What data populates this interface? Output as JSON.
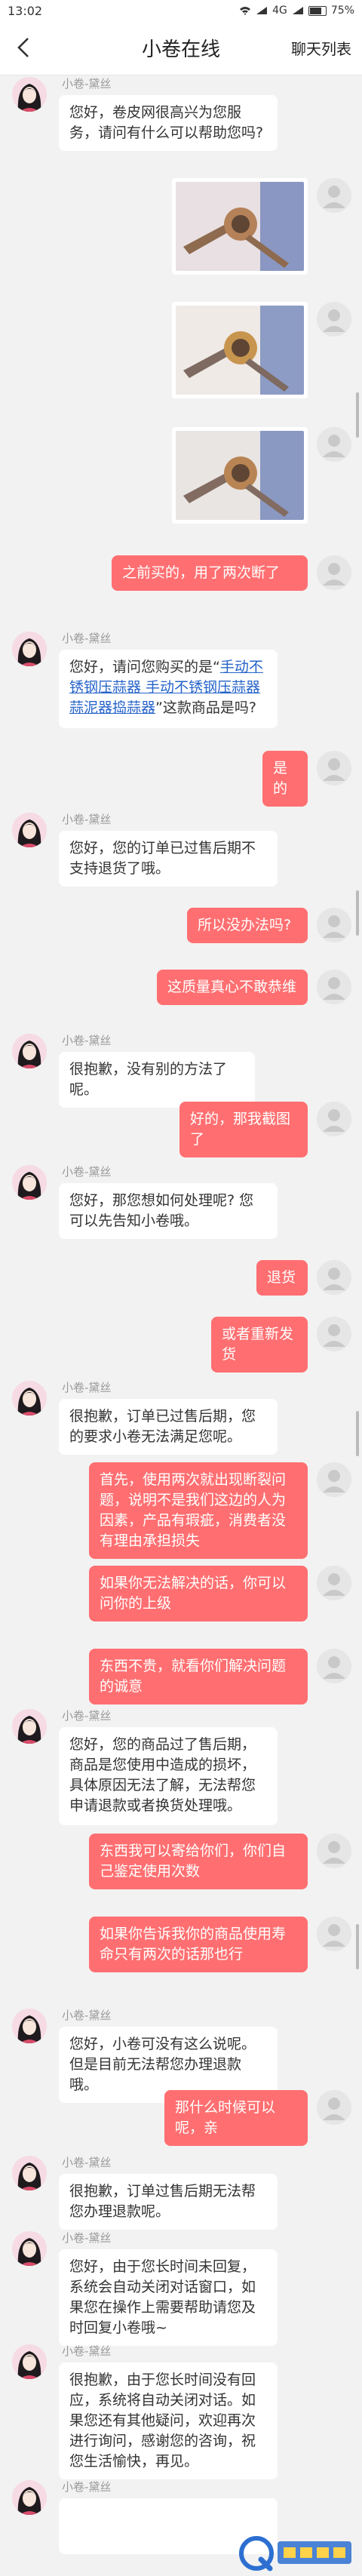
{
  "status_bar": {
    "time": "13:02",
    "network": "4G",
    "battery": "75%"
  },
  "nav": {
    "title": "小卷在线",
    "right_label": "聊天列表"
  },
  "agent_name": "小卷-黛丝",
  "messages": [
    {
      "side": "agent",
      "text": "您好，卷皮网很高兴为您服务，请问有什么可以帮助您吗?"
    },
    {
      "side": "image",
      "alt": "产品图1"
    },
    {
      "side": "image",
      "alt": "产品图2"
    },
    {
      "side": "image",
      "alt": "产品图3"
    },
    {
      "side": "user",
      "text": "之前买的，用了两次断了"
    },
    {
      "side": "agent",
      "text_before": "您好，请问您购买的是“",
      "link": "手动不锈钢压蒜器 手动不锈钢压蒜器蒜泥器捣蒜器",
      "text_after": "”这款商品是吗?"
    },
    {
      "side": "user",
      "text": "是的"
    },
    {
      "side": "agent",
      "text": "您好，您的订单已过售后期不支持退货了哦。"
    },
    {
      "side": "user",
      "text": "所以没办法吗?"
    },
    {
      "side": "user",
      "text": "这质量真心不敢恭维"
    },
    {
      "side": "agent",
      "text": "很抱歉，没有别的方法了呢。"
    },
    {
      "side": "user",
      "text": "好的，那我截图了"
    },
    {
      "side": "agent",
      "text": "您好，那您想如何处理呢? 您可以先告知小卷哦。"
    },
    {
      "side": "user",
      "text": "退货"
    },
    {
      "side": "user",
      "text": "或者重新发货"
    },
    {
      "side": "agent",
      "text": "很抱歉，订单已过售后期，您的要求小卷无法满足您呢。"
    },
    {
      "side": "user",
      "text": "首先，使用两次就出现断裂问题，说明不是我们这边的人为因素，产品有瑕疵，消费者没有理由承担损失"
    },
    {
      "side": "user",
      "text": "如果你无法解决的话，你可以问你的上级"
    },
    {
      "side": "user",
      "text": "东西不贵，就看你们解决问题的诚意"
    },
    {
      "side": "agent",
      "text": "您好，您的商品过了售后期，商品是您使用中造成的损坏，具体原因无法了解，无法帮您申请退款或者换货处理哦。"
    },
    {
      "side": "user",
      "text": "东西我可以寄给你们，你们自己鉴定使用次数"
    },
    {
      "side": "user",
      "text": "如果你告诉我你的商品使用寿命只有两次的话那也行"
    },
    {
      "side": "agent",
      "text": "您好，小卷可没有这么说呢。但是目前无法帮您办理退款哦。"
    },
    {
      "side": "user",
      "text": "那什么时候可以呢，亲"
    },
    {
      "side": "agent",
      "text": "很抱歉，订单过售后期无法帮您办理退款呢。"
    },
    {
      "side": "agent",
      "text": "您好，由于您长时间未回复，系统会自动关闭对话窗口，如果您在操作上需要帮助请您及时回复小卷哦~"
    },
    {
      "side": "agent",
      "text": "很抱歉，由于您长时间没有回应，系统将自动关闭对话。如果您还有其他疑问，欢迎再次进行询问，感谢您的咨询，祝您生活愉快，再见。"
    },
    {
      "side": "agent",
      "text": ""
    }
  ],
  "colors": {
    "user_bubble": "#ff6f71",
    "agent_bubble": "#ffffff",
    "link": "#2563c9",
    "background": "#f2f2f2"
  },
  "icons": {
    "back": "chevron-left-icon",
    "signal": "signal-icon",
    "wifi": "wifi-icon",
    "battery": "battery-icon"
  }
}
